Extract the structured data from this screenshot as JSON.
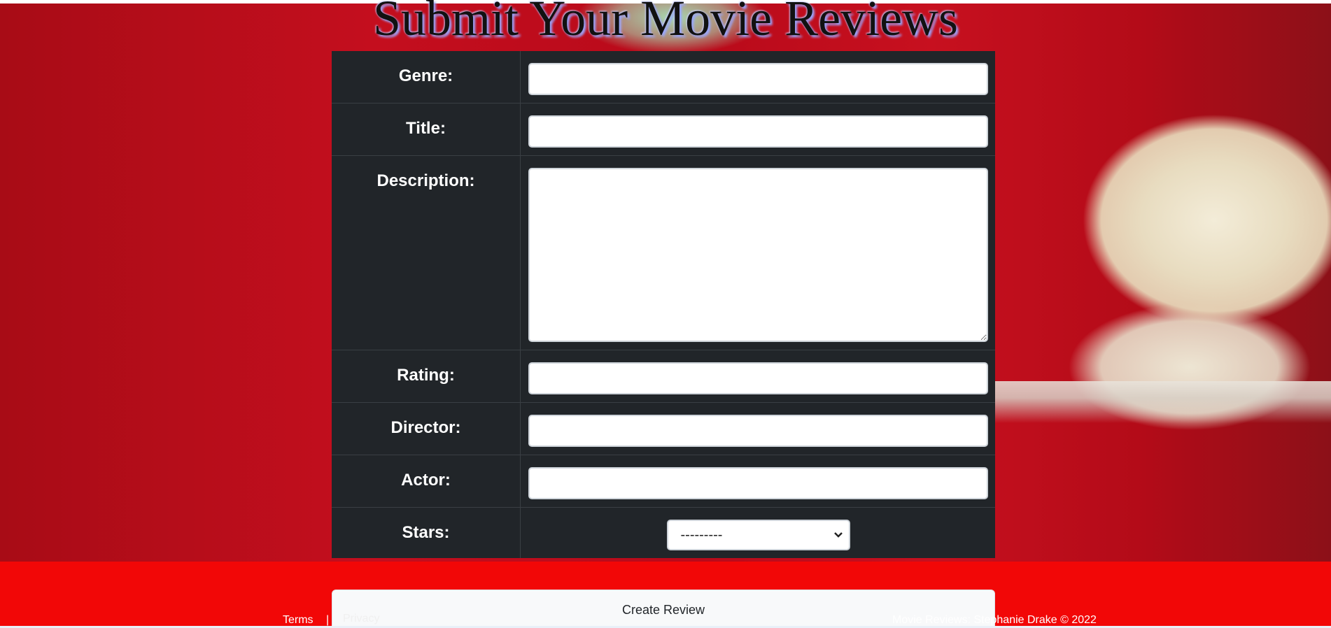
{
  "page": {
    "heading": "Submit Your Movie Reviews"
  },
  "form": {
    "fields": [
      {
        "label": "Genre:",
        "value": ""
      },
      {
        "label": "Title:",
        "value": ""
      },
      {
        "label": "Description:",
        "value": ""
      },
      {
        "label": "Rating:",
        "value": ""
      },
      {
        "label": "Director:",
        "value": ""
      },
      {
        "label": "Actor:",
        "value": ""
      }
    ],
    "stars": {
      "label": "Stars:",
      "selected": "---------"
    },
    "submit_label": "Create Review"
  },
  "footer": {
    "terms": "Terms",
    "separator": "|",
    "privacy": "Privacy",
    "copyright": "Movie Reviews: Stephanie Drake © 2022"
  },
  "colors": {
    "table_bg": "#212529",
    "band_red": "#f20707",
    "background_red": "#c40e1e"
  }
}
